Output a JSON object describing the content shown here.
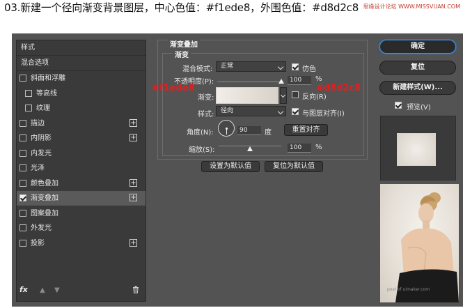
{
  "caption": "03.新建一个径向渐变背景图层，中心色值：#f1ede8，外围色值：#d8d2c8",
  "watermark": "思缘设计论坛 WWW.MISSVUAN.COM",
  "left_panel": {
    "header": "样式",
    "blend_options": "混合选项",
    "items": [
      {
        "label": "斜面和浮雕",
        "checked": false,
        "plus": false
      },
      {
        "label": "等高线",
        "checked": false,
        "plus": false,
        "sub": true
      },
      {
        "label": "纹理",
        "checked": false,
        "plus": false,
        "sub": true
      },
      {
        "label": "描边",
        "checked": false,
        "plus": true
      },
      {
        "label": "内阴影",
        "checked": false,
        "plus": true
      },
      {
        "label": "内发光",
        "checked": false,
        "plus": false
      },
      {
        "label": "光泽",
        "checked": false,
        "plus": false
      },
      {
        "label": "颜色叠加",
        "checked": false,
        "plus": true
      },
      {
        "label": "渐变叠加",
        "checked": true,
        "plus": true,
        "selected": true
      },
      {
        "label": "图案叠加",
        "checked": false,
        "plus": false
      },
      {
        "label": "外发光",
        "checked": false,
        "plus": false
      },
      {
        "label": "投影",
        "checked": false,
        "plus": true
      }
    ],
    "footer": {
      "fx": "fx",
      "trash_icon": "trash-icon"
    }
  },
  "gradient_overlay": {
    "section_title": "渐变叠加",
    "group_title": "渐变",
    "blend_mode_label": "混合模式:",
    "blend_mode_value": "正常",
    "dither_label": "仿色",
    "dither_checked": true,
    "opacity_label": "不透明度(P):",
    "opacity_value": "100",
    "opacity_unit": "%",
    "gradient_label": "渐变:",
    "reverse_label": "反向(R)",
    "reverse_checked": false,
    "style_label": "样式:",
    "style_value": "径向",
    "align_label": "与图层对齐(I)",
    "align_checked": true,
    "angle_label": "角度(N):",
    "angle_value": "90",
    "angle_unit": "度",
    "reset_align_button": "重置对齐",
    "scale_label": "缩放(S):",
    "scale_value": "100",
    "scale_unit": "%",
    "set_default_button": "设置为默认值",
    "reset_default_button": "复位为默认值",
    "center_color": "#f1ede8",
    "outer_color": "#d8d2c8",
    "opacity_fraction": 1.0,
    "scale_fraction": 0.5
  },
  "annotations": {
    "left": "#f1ede8",
    "right": "#d8d2c8"
  },
  "right_buttons": {
    "ok": "确定",
    "reset": "复位",
    "new_style": "新建样式(W)...",
    "preview_label": "预览(V)",
    "preview_checked": true
  },
  "photo_credit": "post of uimaker.com"
}
